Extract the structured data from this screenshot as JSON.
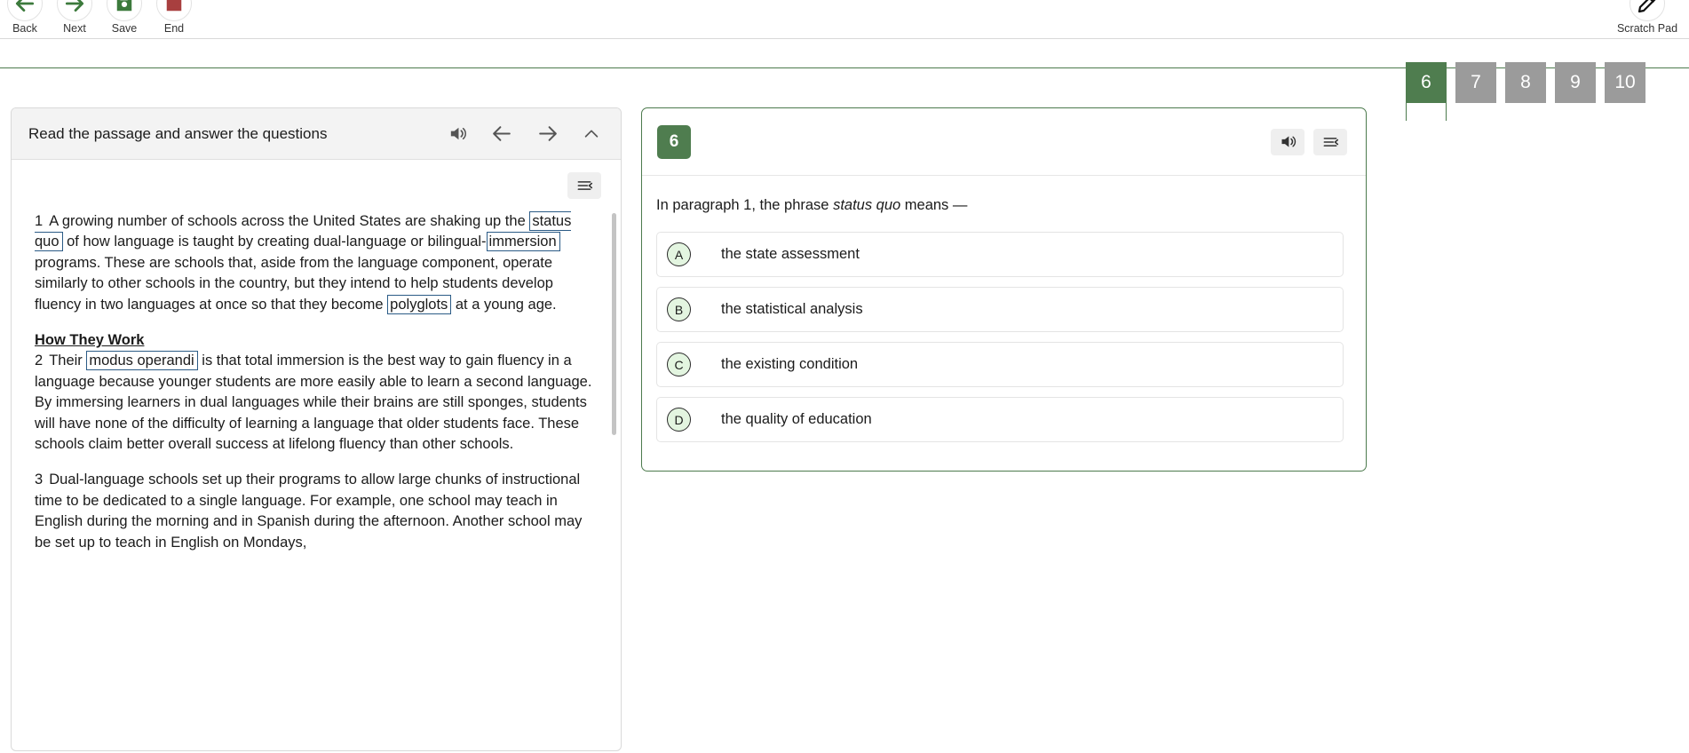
{
  "toolbar": {
    "buttons": [
      {
        "label": "Back",
        "icon": "arrow-left-icon"
      },
      {
        "label": "Next",
        "icon": "arrow-right-icon"
      },
      {
        "label": "Save",
        "icon": "save-disk-icon"
      },
      {
        "label": "End",
        "icon": "stop-square-icon"
      }
    ],
    "scratch_pad": {
      "label": "Scratch Pad",
      "icon": "pencil-icon"
    }
  },
  "question_tabs": {
    "items": [
      "6",
      "7",
      "8",
      "9",
      "10"
    ],
    "active": "6"
  },
  "passage": {
    "title": "Read the passage and answer the questions",
    "header_icons": [
      "speaker-icon",
      "arrow-left-icon",
      "arrow-right-icon",
      "chevron-up-icon"
    ],
    "tool_tab_icon": "text-tools-icon",
    "paragraph1": {
      "number": "1",
      "part1": "A growing number of schools across the United States are shaking up the ",
      "gloss1": "status quo",
      "part2": " of how language is taught by creating dual-language or bilingual-",
      "gloss2": "immersion",
      "part3": " programs. These are schools that, aside from the language component, operate similarly to other schools in the country, but they intend to help students develop fluency in two languages at once so that they become ",
      "gloss3": "polyglots",
      "part4": " at a young age."
    },
    "subhead": "How They Work",
    "paragraph2": {
      "number": "2",
      "part1": "Their ",
      "gloss1": "modus operandi",
      "part2": " is that total immersion is the best way to gain fluency in a language because younger students are more easily able to learn a second language. By immersing learners in dual languages while their brains are still sponges, students will have none of the difficulty of learning a language that older students face. These schools claim better overall success at lifelong fluency than other schools."
    },
    "paragraph3": {
      "number": "3",
      "text": "Dual-language schools set up their programs to allow large chunks of instructional time to be dedicated to a single language. For example, one school may teach in English during the morning and in Spanish during the afternoon. Another school may be set up to teach in English on Mondays,"
    }
  },
  "question": {
    "number": "6",
    "header_icons": [
      "speaker-icon",
      "text-tools-icon"
    ],
    "stem_part1": "In paragraph 1, the phrase ",
    "stem_italic": "status quo",
    "stem_part2": " means —",
    "choices": [
      {
        "letter": "A",
        "text": "the state assessment"
      },
      {
        "letter": "B",
        "text": "the statistical analysis"
      },
      {
        "letter": "C",
        "text": "the existing condition"
      },
      {
        "letter": "D",
        "text": "the quality of education"
      }
    ]
  },
  "colors": {
    "brand_green": "#4f7d4f",
    "tab_gray": "#9b9b9b",
    "gloss_border": "#2b5b86",
    "choice_circle_fill": "#e3f5e0"
  }
}
